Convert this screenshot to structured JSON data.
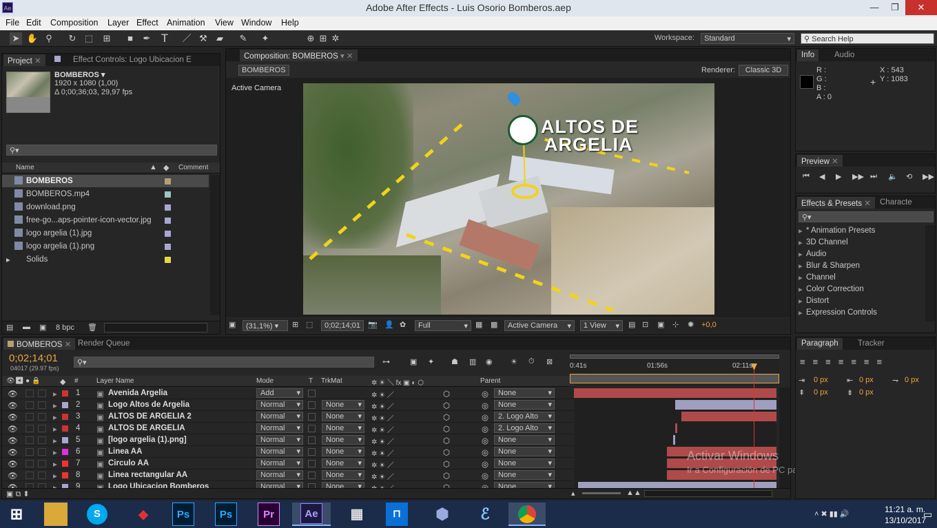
{
  "window": {
    "title": "Adobe After Effects - Luis Osorio Bomberos.aep",
    "app_badge": "Ae",
    "minimize": "—",
    "restore": "❐",
    "close": "✕"
  },
  "menu": [
    "File",
    "Edit",
    "Composition",
    "Layer",
    "Effect",
    "Animation",
    "View",
    "Window",
    "Help"
  ],
  "toolbar": {
    "workspace_label": "Workspace:",
    "workspace_value": "Standard",
    "search_placeholder": "Search Help"
  },
  "project": {
    "tab_project": "Project",
    "tab_effect": "Effect Controls: Logo Ubicacion E",
    "comp_name": "BOMBEROS ▾",
    "comp_size": "1920 x 1080 (1,00)",
    "comp_duration": "Δ 0;00;36;03, 29,97 fps",
    "col_name": "Name",
    "col_comment": "Comment",
    "bpc": "8 bpc",
    "items": [
      {
        "name": "BOMBEROS",
        "color": "#b59f74",
        "icon": "composition-icon"
      },
      {
        "name": "BOMBEROS.mp4",
        "color": "#9ac7c0",
        "icon": "footage-icon"
      },
      {
        "name": "download.png",
        "color": "#a7a7cf",
        "icon": "image-icon"
      },
      {
        "name": "free-go...aps-pointer-icon-vector.jpg",
        "color": "#a7a7cf",
        "icon": "image-icon"
      },
      {
        "name": "logo argelia (1).jpg",
        "color": "#a7a7cf",
        "icon": "image-icon"
      },
      {
        "name": "logo argelia (1).png",
        "color": "#a7a7cf",
        "icon": "image-icon"
      },
      {
        "name": "Solids",
        "color": "#e7d746",
        "icon": "folder-icon"
      }
    ]
  },
  "composition": {
    "tab": "Composition: BOMBEROS",
    "breadcrumb": "BOMBEROS",
    "renderer_label": "Renderer:",
    "renderer_value": "Classic 3D",
    "camera_label": "Active Camera",
    "overlay_line1": "ALTOS DE",
    "overlay_line2": "ARGELIA",
    "zoom": "(31,1%)",
    "timecode": "0;02;14;01",
    "resolution": "Full",
    "camera_select": "Active Camera",
    "views": "1 View",
    "exposure": "+0,0"
  },
  "info": {
    "tab_info": "Info",
    "tab_audio": "Audio",
    "r": "R :",
    "g": "G :",
    "b": "B :",
    "a": "A : 0",
    "x": "X : 543",
    "y": "Y : 1083"
  },
  "preview": {
    "tab": "Preview"
  },
  "effects": {
    "tab": "Effects & Presets",
    "tab2": "Characte",
    "items": [
      "* Animation Presets",
      "3D Channel",
      "Audio",
      "Blur & Sharpen",
      "Channel",
      "Color Correction",
      "Distort",
      "Expression Controls"
    ]
  },
  "paragraph": {
    "tab": "Paragraph",
    "tab2": "Tracker",
    "v1": "0 px",
    "v2": "0 px",
    "v3": "0 px",
    "v4": "0 px",
    "v5": "0 px"
  },
  "timeline": {
    "tab": "BOMBEROS",
    "tab2": "Render Queue",
    "timecode": "0;02;14;01",
    "frames": "04017 (29.97 fps)",
    "col_num": "#",
    "col_layer": "Layer Name",
    "col_mode": "Mode",
    "col_t": "T",
    "col_trk": "TrkMat",
    "col_parent": "Parent",
    "ruler": [
      "0:41s",
      "01:56s",
      "02:11s"
    ],
    "layers": [
      {
        "num": "1",
        "name": "Avenida Argelia",
        "color": "#cc3333",
        "mode": "Add",
        "trk": "",
        "parent": "None",
        "bar_start": 0.0,
        "bar_end": 1.0,
        "bar_color": "#b04a4a"
      },
      {
        "num": "2",
        "name": "Logo Altos de Argelia",
        "color": "#a7a7cf",
        "mode": "Normal",
        "trk": "None",
        "parent": "None",
        "bar_start": 0.5,
        "bar_end": 1.0,
        "bar_color": "#9fa0bf"
      },
      {
        "num": "3",
        "name": "ALTOS DE    ARGELIA 2",
        "color": "#cc3333",
        "mode": "Normal",
        "trk": "None",
        "parent": "2. Logo Alto",
        "bar_start": 0.53,
        "bar_end": 1.0,
        "bar_color": "#b04a4a"
      },
      {
        "num": "4",
        "name": "ALTOS DE    ARGELIA",
        "color": "#cc3333",
        "mode": "Normal",
        "trk": "None",
        "parent": "2. Logo Alto",
        "bar_start": 0.5,
        "bar_end": 0.51,
        "bar_color": "#b04a4a"
      },
      {
        "num": "5",
        "name": "[logo argelia (1).png]",
        "color": "#a7a7cf",
        "mode": "Normal",
        "trk": "None",
        "parent": "None",
        "bar_start": 0.49,
        "bar_end": 0.5,
        "bar_color": "#9fa0bf"
      },
      {
        "num": "6",
        "name": "Linea AA",
        "color": "#e22ee2",
        "mode": "Normal",
        "trk": "None",
        "parent": "None",
        "bar_start": 0.46,
        "bar_end": 1.0,
        "bar_color": "#b04a4a"
      },
      {
        "num": "7",
        "name": "Circulo AA",
        "color": "#ee3333",
        "mode": "Normal",
        "trk": "None",
        "parent": "None",
        "bar_start": 0.46,
        "bar_end": 1.0,
        "bar_color": "#b04a4a"
      },
      {
        "num": "8",
        "name": "Linea rectangular AA",
        "color": "#ee3333",
        "mode": "Normal",
        "trk": "None",
        "parent": "None",
        "bar_start": 0.46,
        "bar_end": 1.0,
        "bar_color": "#b04a4a"
      },
      {
        "num": "9",
        "name": "Logo Ubicacion Bomberos",
        "color": "#a7a7cf",
        "mode": "Normal",
        "trk": "None",
        "parent": "None",
        "bar_start": 0.02,
        "bar_end": 1.0,
        "bar_color": "#9fa0bf"
      }
    ]
  },
  "watermark": {
    "line1": "Activar Windows",
    "line2": "Ir a Configuración de PC para activar Windows."
  },
  "taskbar": {
    "time": "11:21 a. m.",
    "date": "13/10/2017"
  }
}
